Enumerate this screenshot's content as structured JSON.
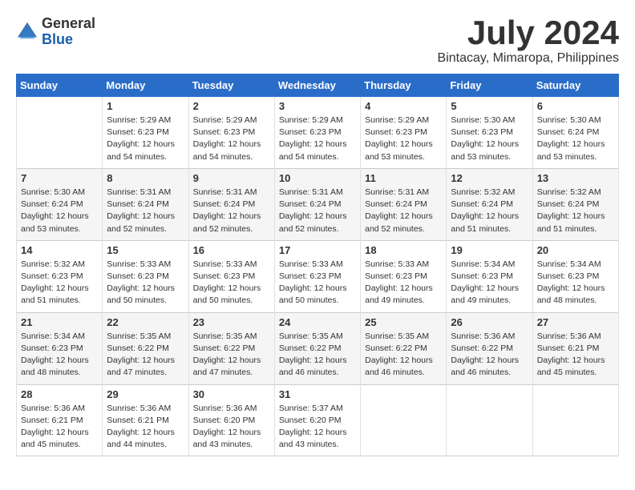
{
  "logo": {
    "general": "General",
    "blue": "Blue"
  },
  "title": "July 2024",
  "location": "Bintacay, Mimaropa, Philippines",
  "weekdays": [
    "Sunday",
    "Monday",
    "Tuesday",
    "Wednesday",
    "Thursday",
    "Friday",
    "Saturday"
  ],
  "weeks": [
    [
      {
        "day": "",
        "sunrise": "",
        "sunset": "",
        "daylight": ""
      },
      {
        "day": "1",
        "sunrise": "Sunrise: 5:29 AM",
        "sunset": "Sunset: 6:23 PM",
        "daylight": "Daylight: 12 hours and 54 minutes."
      },
      {
        "day": "2",
        "sunrise": "Sunrise: 5:29 AM",
        "sunset": "Sunset: 6:23 PM",
        "daylight": "Daylight: 12 hours and 54 minutes."
      },
      {
        "day": "3",
        "sunrise": "Sunrise: 5:29 AM",
        "sunset": "Sunset: 6:23 PM",
        "daylight": "Daylight: 12 hours and 54 minutes."
      },
      {
        "day": "4",
        "sunrise": "Sunrise: 5:29 AM",
        "sunset": "Sunset: 6:23 PM",
        "daylight": "Daylight: 12 hours and 53 minutes."
      },
      {
        "day": "5",
        "sunrise": "Sunrise: 5:30 AM",
        "sunset": "Sunset: 6:23 PM",
        "daylight": "Daylight: 12 hours and 53 minutes."
      },
      {
        "day": "6",
        "sunrise": "Sunrise: 5:30 AM",
        "sunset": "Sunset: 6:24 PM",
        "daylight": "Daylight: 12 hours and 53 minutes."
      }
    ],
    [
      {
        "day": "7",
        "sunrise": "Sunrise: 5:30 AM",
        "sunset": "Sunset: 6:24 PM",
        "daylight": "Daylight: 12 hours and 53 minutes."
      },
      {
        "day": "8",
        "sunrise": "Sunrise: 5:31 AM",
        "sunset": "Sunset: 6:24 PM",
        "daylight": "Daylight: 12 hours and 52 minutes."
      },
      {
        "day": "9",
        "sunrise": "Sunrise: 5:31 AM",
        "sunset": "Sunset: 6:24 PM",
        "daylight": "Daylight: 12 hours and 52 minutes."
      },
      {
        "day": "10",
        "sunrise": "Sunrise: 5:31 AM",
        "sunset": "Sunset: 6:24 PM",
        "daylight": "Daylight: 12 hours and 52 minutes."
      },
      {
        "day": "11",
        "sunrise": "Sunrise: 5:31 AM",
        "sunset": "Sunset: 6:24 PM",
        "daylight": "Daylight: 12 hours and 52 minutes."
      },
      {
        "day": "12",
        "sunrise": "Sunrise: 5:32 AM",
        "sunset": "Sunset: 6:24 PM",
        "daylight": "Daylight: 12 hours and 51 minutes."
      },
      {
        "day": "13",
        "sunrise": "Sunrise: 5:32 AM",
        "sunset": "Sunset: 6:24 PM",
        "daylight": "Daylight: 12 hours and 51 minutes."
      }
    ],
    [
      {
        "day": "14",
        "sunrise": "Sunrise: 5:32 AM",
        "sunset": "Sunset: 6:23 PM",
        "daylight": "Daylight: 12 hours and 51 minutes."
      },
      {
        "day": "15",
        "sunrise": "Sunrise: 5:33 AM",
        "sunset": "Sunset: 6:23 PM",
        "daylight": "Daylight: 12 hours and 50 minutes."
      },
      {
        "day": "16",
        "sunrise": "Sunrise: 5:33 AM",
        "sunset": "Sunset: 6:23 PM",
        "daylight": "Daylight: 12 hours and 50 minutes."
      },
      {
        "day": "17",
        "sunrise": "Sunrise: 5:33 AM",
        "sunset": "Sunset: 6:23 PM",
        "daylight": "Daylight: 12 hours and 50 minutes."
      },
      {
        "day": "18",
        "sunrise": "Sunrise: 5:33 AM",
        "sunset": "Sunset: 6:23 PM",
        "daylight": "Daylight: 12 hours and 49 minutes."
      },
      {
        "day": "19",
        "sunrise": "Sunrise: 5:34 AM",
        "sunset": "Sunset: 6:23 PM",
        "daylight": "Daylight: 12 hours and 49 minutes."
      },
      {
        "day": "20",
        "sunrise": "Sunrise: 5:34 AM",
        "sunset": "Sunset: 6:23 PM",
        "daylight": "Daylight: 12 hours and 48 minutes."
      }
    ],
    [
      {
        "day": "21",
        "sunrise": "Sunrise: 5:34 AM",
        "sunset": "Sunset: 6:23 PM",
        "daylight": "Daylight: 12 hours and 48 minutes."
      },
      {
        "day": "22",
        "sunrise": "Sunrise: 5:35 AM",
        "sunset": "Sunset: 6:22 PM",
        "daylight": "Daylight: 12 hours and 47 minutes."
      },
      {
        "day": "23",
        "sunrise": "Sunrise: 5:35 AM",
        "sunset": "Sunset: 6:22 PM",
        "daylight": "Daylight: 12 hours and 47 minutes."
      },
      {
        "day": "24",
        "sunrise": "Sunrise: 5:35 AM",
        "sunset": "Sunset: 6:22 PM",
        "daylight": "Daylight: 12 hours and 46 minutes."
      },
      {
        "day": "25",
        "sunrise": "Sunrise: 5:35 AM",
        "sunset": "Sunset: 6:22 PM",
        "daylight": "Daylight: 12 hours and 46 minutes."
      },
      {
        "day": "26",
        "sunrise": "Sunrise: 5:36 AM",
        "sunset": "Sunset: 6:22 PM",
        "daylight": "Daylight: 12 hours and 46 minutes."
      },
      {
        "day": "27",
        "sunrise": "Sunrise: 5:36 AM",
        "sunset": "Sunset: 6:21 PM",
        "daylight": "Daylight: 12 hours and 45 minutes."
      }
    ],
    [
      {
        "day": "28",
        "sunrise": "Sunrise: 5:36 AM",
        "sunset": "Sunset: 6:21 PM",
        "daylight": "Daylight: 12 hours and 45 minutes."
      },
      {
        "day": "29",
        "sunrise": "Sunrise: 5:36 AM",
        "sunset": "Sunset: 6:21 PM",
        "daylight": "Daylight: 12 hours and 44 minutes."
      },
      {
        "day": "30",
        "sunrise": "Sunrise: 5:36 AM",
        "sunset": "Sunset: 6:20 PM",
        "daylight": "Daylight: 12 hours and 43 minutes."
      },
      {
        "day": "31",
        "sunrise": "Sunrise: 5:37 AM",
        "sunset": "Sunset: 6:20 PM",
        "daylight": "Daylight: 12 hours and 43 minutes."
      },
      {
        "day": "",
        "sunrise": "",
        "sunset": "",
        "daylight": ""
      },
      {
        "day": "",
        "sunrise": "",
        "sunset": "",
        "daylight": ""
      },
      {
        "day": "",
        "sunrise": "",
        "sunset": "",
        "daylight": ""
      }
    ]
  ]
}
